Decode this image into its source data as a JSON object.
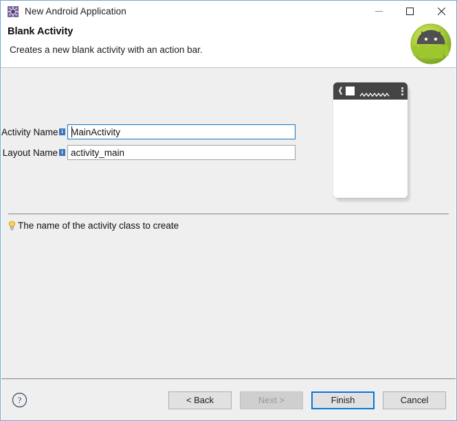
{
  "window": {
    "title": "New Android Application",
    "title_icon": "android-sdk-gear-icon",
    "controls": {
      "minimize": "minimize-icon",
      "maximize": "maximize-icon",
      "close": "close-icon"
    }
  },
  "header": {
    "title": "Blank Activity",
    "subtitle": "Creates a new blank activity with an action bar.",
    "logo": "android-robot-logo"
  },
  "form": {
    "fields": [
      {
        "label": "Activity Name",
        "info_icon": "info-icon",
        "value": "MainActivity",
        "placeholder": "Activity Name",
        "focused": true
      },
      {
        "label": "Layout Name",
        "info_icon": "info-icon",
        "value": "activity_main",
        "placeholder": "Layout Name",
        "focused": false
      }
    ]
  },
  "preview": {
    "name": "blank-activity-phone-preview",
    "action_bar": {
      "back_icon": "back-chevron-icon",
      "app_icon": "app-square-icon",
      "title_placeholder": "squiggle-title-placeholder",
      "overflow_icon": "overflow-menu-icon"
    },
    "colors": {
      "action_bar": "#444444",
      "screen": "#ffffff"
    }
  },
  "hint": {
    "icon": "lightbulb-icon",
    "text": "The name of the activity class to create"
  },
  "footer": {
    "help_icon": "help-question-icon",
    "buttons": [
      {
        "label": "< Back",
        "state": "enabled",
        "name": "back-button"
      },
      {
        "label": "Next >",
        "state": "disabled",
        "name": "next-button"
      },
      {
        "label": "Finish",
        "state": "default",
        "name": "finish-button"
      },
      {
        "label": "Cancel",
        "state": "enabled",
        "name": "cancel-button"
      }
    ]
  },
  "colors": {
    "accent": "#0078d7",
    "window_border": "#6fa8d4",
    "content_bg": "#efefef",
    "info_badge": "#3a76b8",
    "android_green": "#a4c639"
  }
}
